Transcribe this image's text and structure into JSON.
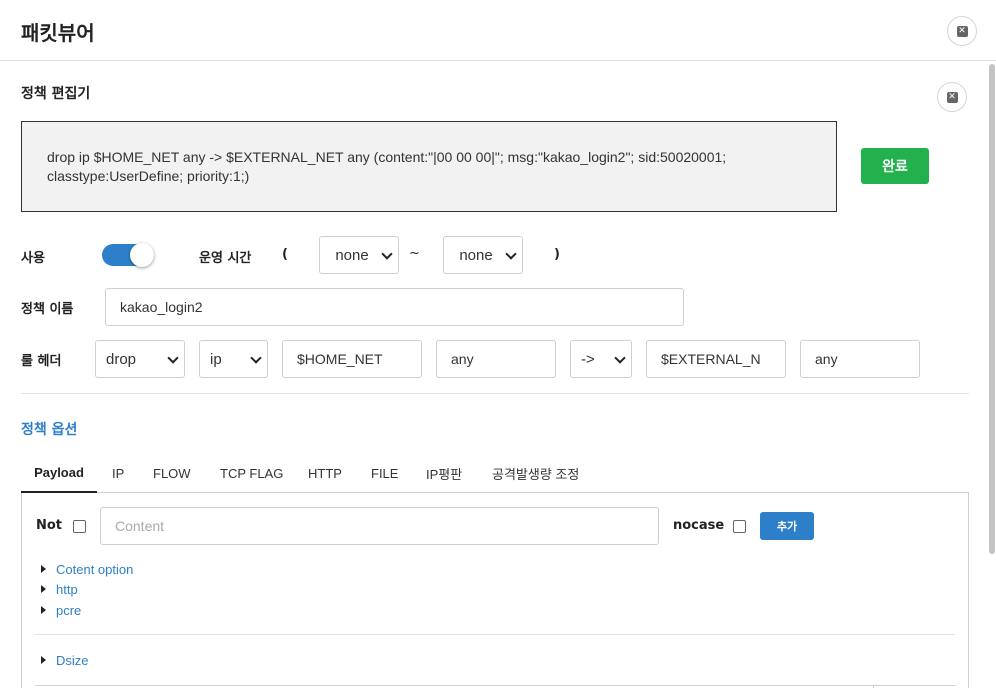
{
  "window": {
    "title": "패킷뷰어"
  },
  "editor": {
    "title": "정책 편집기",
    "rule_text": "drop ip $HOME_NET any -> $EXTERNAL_NET any (content:\"|00 00 00|\"; msg:\"kakao_login2\"; sid:50020001; classtype:UserDefine; priority:1;)",
    "done_label": "완료"
  },
  "settings": {
    "use_label": "사용",
    "use_enabled": true,
    "op_time_label": "운영 시간",
    "paren_open": "(",
    "start_time": "none",
    "tilde": "~",
    "end_time": "none",
    "paren_close": ")",
    "policy_name_label": "정책 이름",
    "policy_name_value": "kakao_login2",
    "rule_header_label": "룰 헤더",
    "rule_header": {
      "action": "drop",
      "protocol": "ip",
      "src_net": "$HOME_NET",
      "src_port": "any",
      "direction": "->",
      "dst_net": "$EXTERNAL_N",
      "dst_port": "any"
    }
  },
  "options": {
    "title": "정책 옵션",
    "tabs": [
      "Payload",
      "IP",
      "FLOW",
      "TCP FLAG",
      "HTTP",
      "FILE",
      "IP평판",
      "공격발생량 조정"
    ],
    "active_tab": "Payload",
    "payload": {
      "not_label": "Not",
      "content_placeholder": "Content",
      "nocase_label": "nocase",
      "add_label": "추가",
      "tree_items": [
        "Cotent option",
        "http",
        "pcre"
      ],
      "dsize_label": "Dsize"
    }
  },
  "colors": {
    "accent_blue": "#2d7fc9",
    "done_green": "#22b14c"
  },
  "icons": {
    "window_close": "close-icon",
    "editor_close": "close-icon",
    "tree_toggle": "caret-right-icon",
    "select_caret": "chevron-down-icon"
  }
}
